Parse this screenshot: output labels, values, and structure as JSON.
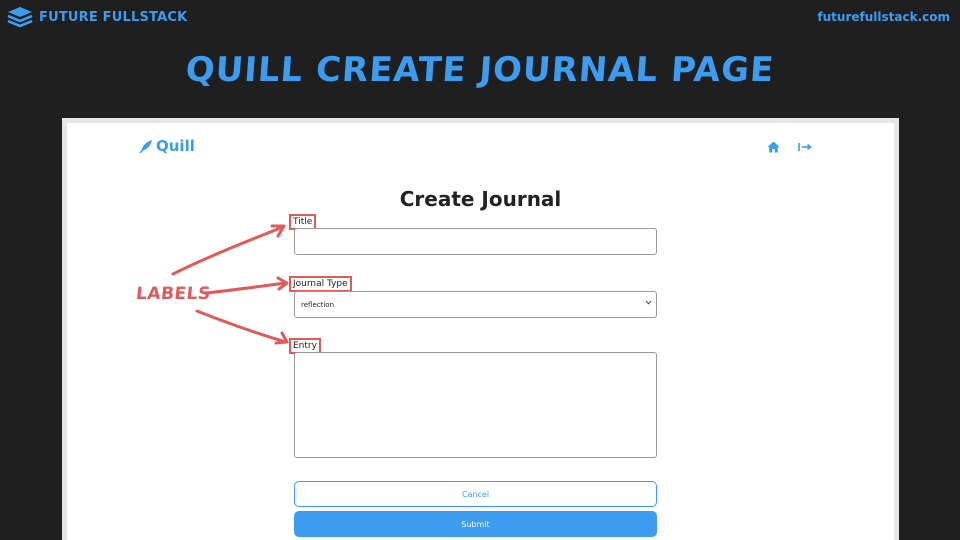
{
  "slide": {
    "brand_name": "FUTURE FULLSTACK",
    "site_url": "futurefullstack.com",
    "title": "QUILL CREATE JOURNAL PAGE",
    "annotation": "LABELS"
  },
  "app": {
    "logo_text": "Quill",
    "nav": {
      "home_icon": "home-icon",
      "logout_icon": "logout-icon"
    }
  },
  "form": {
    "heading": "Create Journal",
    "title_label": "Title",
    "title_value": "",
    "type_label": "Journal Type",
    "type_value": "reflection",
    "entry_label": "Entry",
    "entry_value": "",
    "cancel_label": "Cancel",
    "submit_label": "Submit"
  },
  "colors": {
    "accent": "#3b9cf0",
    "annotation": "#e05a5a",
    "background": "#1f1f1f"
  }
}
